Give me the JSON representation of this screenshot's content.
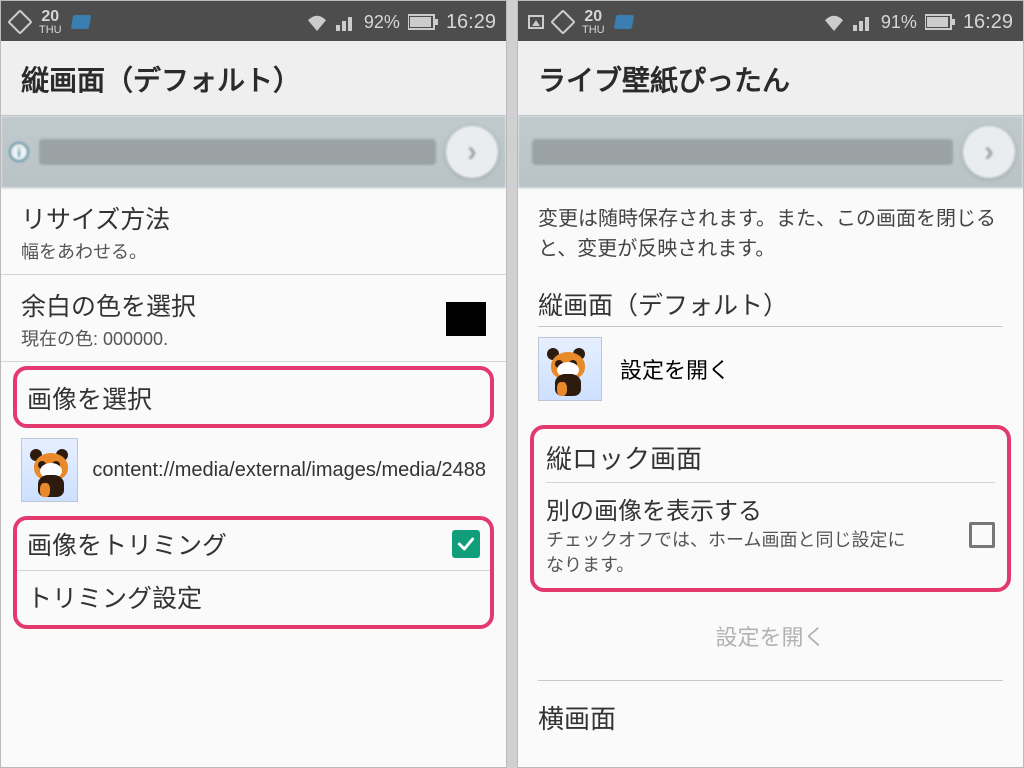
{
  "left": {
    "statusbar": {
      "day_num": "20",
      "day_label": "THU",
      "battery": "92%",
      "time": "16:29"
    },
    "title": "縦画面（デフォルト）",
    "resize": {
      "title": "リサイズ方法",
      "sub": "幅をあわせる。"
    },
    "margin": {
      "title": "余白の色を選択",
      "sub": "現在の色: 000000.",
      "color": "#000000"
    },
    "select_image": "画像を選択",
    "image_path": "content://media/external/images/media/2488",
    "trim_image": "画像をトリミング",
    "trim_settings": "トリミング設定"
  },
  "right": {
    "statusbar": {
      "day_num": "20",
      "day_label": "THU",
      "battery": "91%",
      "time": "16:29"
    },
    "title": "ライブ壁紙ぴったん",
    "info": "変更は随時保存されます。また、この画面を閉じると、変更が反映されます。",
    "portrait_head": "縦画面（デフォルト）",
    "open_settings": "設定を開く",
    "lock_head": "縦ロック画面",
    "lock_main": "別の画像を表示する",
    "lock_sub": "チェックオフでは、ホーム画面と同じ設定になります。",
    "disabled_open": "設定を開く",
    "landscape_head": "横画面"
  }
}
